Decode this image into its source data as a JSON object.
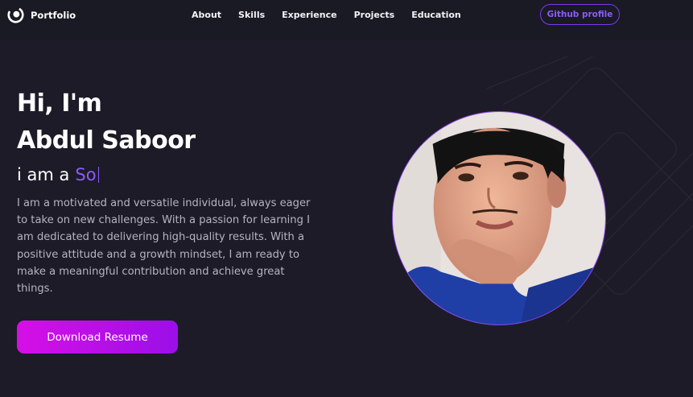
{
  "brand": {
    "name": "Portfolio",
    "icon": "portfolio-logo-icon"
  },
  "nav": {
    "links": [
      "About",
      "Skills",
      "Experience",
      "Projects",
      "Education"
    ],
    "github_label": "Github profile"
  },
  "hero": {
    "greeting": "Hi, I'm",
    "name": "Abdul Saboor",
    "typing_prefix": "i am a",
    "typing_text": "So",
    "bio": "I am a motivated and versatile individual, always eager to take on new challenges. With a passion for learning I am dedicated to delivering high-quality results. With a positive attitude and a growth mindset, I am ready to make a meaningful contribution and achieve great things.",
    "download_label": "Download Resume"
  },
  "profile_image": {
    "icon": "profile-photo",
    "border_color": "#8a3ff0"
  },
  "colors": {
    "accent": "#8b5cf6",
    "button_start": "#d60fe6",
    "button_end": "#9b0fe8",
    "background": "#1c1b27"
  }
}
